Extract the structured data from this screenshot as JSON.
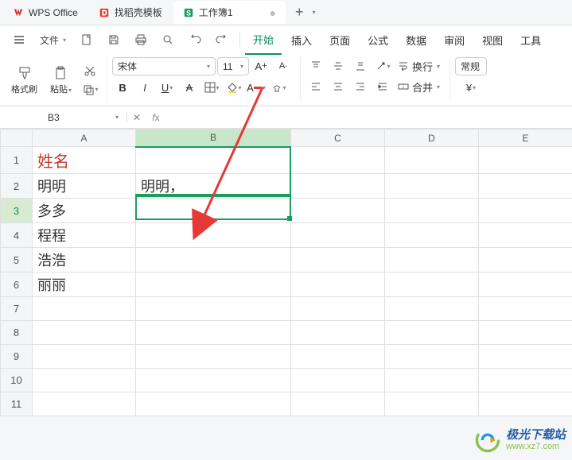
{
  "tabs": [
    {
      "label": "WPS Office",
      "icon": "wps"
    },
    {
      "label": "找稻壳模板",
      "icon": "docer"
    },
    {
      "label": "工作簿1",
      "icon": "sheet",
      "active": true
    }
  ],
  "file_menu": "文件",
  "menu": {
    "items": [
      "开始",
      "插入",
      "页面",
      "公式",
      "数据",
      "审阅",
      "视图",
      "工具"
    ],
    "active": "开始"
  },
  "ribbon": {
    "format_painter": "格式刷",
    "paste": "粘贴",
    "font_name": "宋体",
    "font_size": "11",
    "wrap": "换行",
    "merge": "合并",
    "general": "常规",
    "currency": "¥"
  },
  "name_box": "B3",
  "formula_value": "",
  "columns": [
    "A",
    "B",
    "C",
    "D",
    "E"
  ],
  "rows": [
    {
      "n": "1",
      "A": "姓名",
      "header": true
    },
    {
      "n": "2",
      "A": "明明",
      "B": "明明，"
    },
    {
      "n": "3",
      "A": "多多",
      "active": true
    },
    {
      "n": "4",
      "A": "程程"
    },
    {
      "n": "5",
      "A": "浩浩"
    },
    {
      "n": "6",
      "A": "丽丽"
    },
    {
      "n": "7"
    },
    {
      "n": "8"
    },
    {
      "n": "9"
    },
    {
      "n": "10"
    },
    {
      "n": "11"
    }
  ],
  "selection": {
    "cell": "B3"
  },
  "watermark": {
    "title": "极光下载站",
    "url": "www.xz7.com"
  }
}
